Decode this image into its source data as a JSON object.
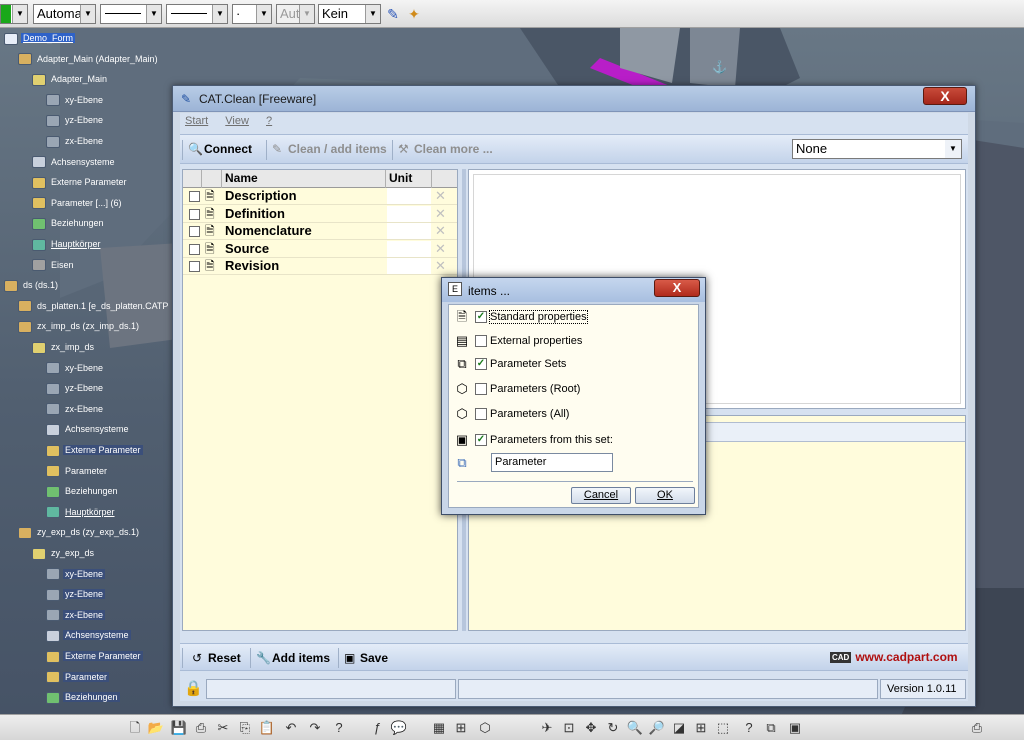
{
  "top_toolbar": {
    "color_dd": "",
    "layer_dd": "Automa",
    "linetype_dd": "",
    "linewidth_dd": "",
    "point_dd": "·",
    "auto_dd": "Aut",
    "render_dd": "Kein"
  },
  "spec_tree": [
    {
      "label": "Demo_Form",
      "style": "sel"
    },
    {
      "label": "Adapter_Main (Adapter_Main)",
      "style": ""
    },
    {
      "label": "Adapter_Main",
      "style": ""
    },
    {
      "label": "xy-Ebene",
      "style": ""
    },
    {
      "label": "yz-Ebene",
      "style": ""
    },
    {
      "label": "zx-Ebene",
      "style": ""
    },
    {
      "label": "Achsensysteme",
      "style": ""
    },
    {
      "label": "Externe Parameter",
      "style": ""
    },
    {
      "label": "Parameter [...] (6)",
      "style": ""
    },
    {
      "label": "Beziehungen",
      "style": ""
    },
    {
      "label": "Hauptkörper",
      "style": "ul"
    },
    {
      "label": "Eisen",
      "style": ""
    },
    {
      "label": "ds (ds.1)",
      "style": ""
    },
    {
      "label": "ds_platten.1 [e_ds_platten.CATP",
      "style": ""
    },
    {
      "label": "zx_imp_ds (zx_imp_ds.1)",
      "style": ""
    },
    {
      "label": "zx_imp_ds",
      "style": ""
    },
    {
      "label": "xy-Ebene",
      "style": ""
    },
    {
      "label": "yz-Ebene",
      "style": ""
    },
    {
      "label": "zx-Ebene",
      "style": ""
    },
    {
      "label": "Achsensysteme",
      "style": ""
    },
    {
      "label": "Externe Parameter",
      "style": "hl"
    },
    {
      "label": "Parameter",
      "style": ""
    },
    {
      "label": "Beziehungen",
      "style": ""
    },
    {
      "label": "Hauptkörper",
      "style": "ul"
    },
    {
      "label": "zy_exp_ds (zy_exp_ds.1)",
      "style": ""
    },
    {
      "label": "zy_exp_ds",
      "style": ""
    },
    {
      "label": "xy-Ebene",
      "style": "hl"
    },
    {
      "label": "yz-Ebene",
      "style": "hl"
    },
    {
      "label": "zx-Ebene",
      "style": "hl"
    },
    {
      "label": "Achsensysteme",
      "style": "hl"
    },
    {
      "label": "Externe Parameter",
      "style": "hl"
    },
    {
      "label": "Parameter",
      "style": "hl"
    },
    {
      "label": "Beziehungen",
      "style": "hl"
    }
  ],
  "main_dialog": {
    "title": "CAT.Clean [Freeware]",
    "close": "X",
    "menu": {
      "start": "Start",
      "view": "View",
      "help": "?"
    },
    "toolbar": {
      "connect": "Connect",
      "clean_add": "Clean / add items",
      "clean_more": "Clean more ...",
      "filter_value": "None"
    },
    "grid": {
      "col_name": "Name",
      "col_unit": "Unit",
      "rows": [
        {
          "name": "Description",
          "checked": false
        },
        {
          "name": "Definition",
          "checked": false
        },
        {
          "name": "Nomenclature",
          "checked": false
        },
        {
          "name": "Source",
          "checked": false
        },
        {
          "name": "Revision",
          "checked": false
        }
      ]
    },
    "bottom_toolbar": {
      "reset": "Reset",
      "add_items": "Add items",
      "save": "Save",
      "logo_badge": "CAD",
      "logo_url": "www.cadpart.com"
    },
    "status": {
      "version": "Version 1.0.11"
    }
  },
  "items_dialog": {
    "title": "items ...",
    "close": "X",
    "options": [
      {
        "label": "Standard properties",
        "checked": true
      },
      {
        "label": "External properties",
        "checked": false
      },
      {
        "label": "Parameter Sets",
        "checked": true
      },
      {
        "label": "Parameters  (Root)",
        "checked": false
      },
      {
        "label": "Parameters (All)",
        "checked": false
      },
      {
        "label": "Parameters from this set:",
        "checked": true
      }
    ],
    "param_set_value": "Parameter",
    "cancel": "Cancel",
    "ok": "OK"
  },
  "colors": {
    "accent": "#2f62c8",
    "logo_red": "#b01010",
    "panel_yellow": "#fffcdc",
    "check_green": "#1a7a1a"
  }
}
